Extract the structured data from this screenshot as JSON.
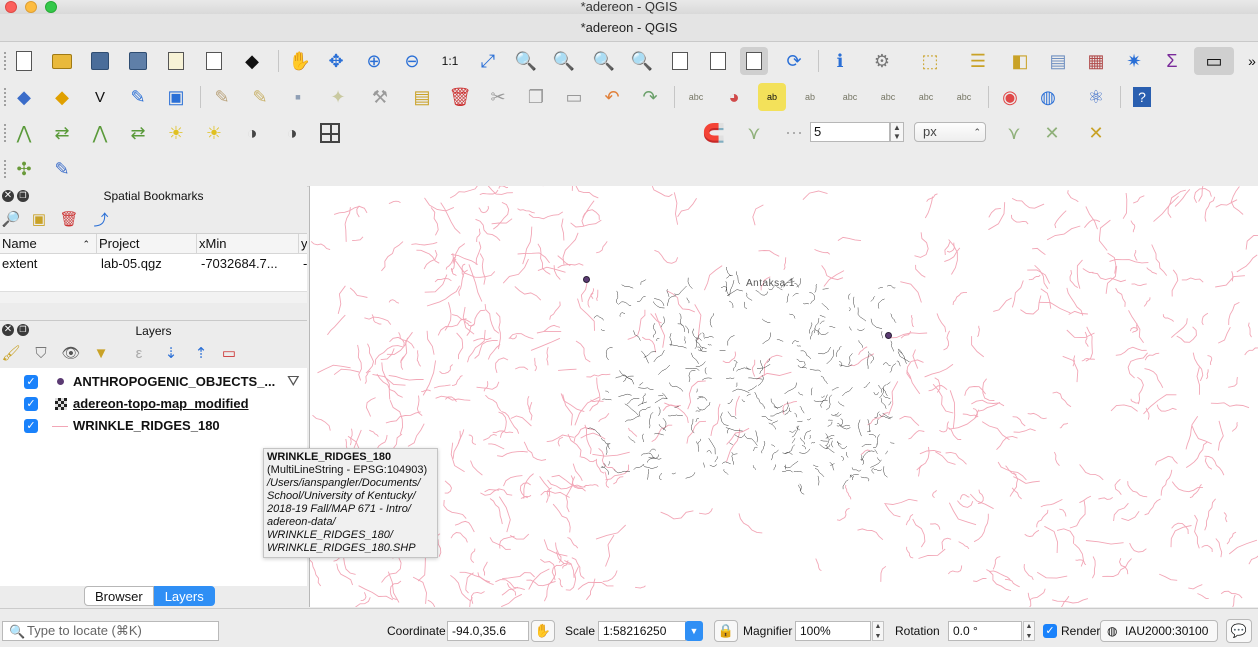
{
  "window": {
    "title": "*adereon - QGIS",
    "tab_title": "*adereon - QGIS"
  },
  "toolbar3": {
    "snap_tolerance": "5",
    "snap_units": "px"
  },
  "bookmarks_panel": {
    "title": "Spatial Bookmarks",
    "columns": [
      "Name",
      "Project",
      "xMin",
      "y"
    ],
    "rows": [
      {
        "name": "extent",
        "project": "lab-05.qgz",
        "xmin": "-7032684.7...",
        "y": "-"
      }
    ]
  },
  "layers_panel": {
    "title": "Layers",
    "layers": [
      {
        "name": "ANTHROPOGENIC_OBJECTS_...",
        "checked": true,
        "symbol": "point-symbol-icon"
      },
      {
        "name": "adereon-topo-map_modified",
        "checked": true,
        "symbol": "raster-symbol-icon"
      },
      {
        "name": "WRINKLE_RIDGES_180",
        "checked": true,
        "symbol": "line-symbol-icon"
      }
    ],
    "tabs": [
      "Browser",
      "Layers"
    ],
    "active_tab": "Layers"
  },
  "tooltip": {
    "title": "WRINKLE_RIDGES_180",
    "crs_line": "(MultiLineString - EPSG:104903)",
    "path_lines": [
      "/Users/ianspangler/Documents/",
      "School/University of Kentucky/",
      "2018-19 Fall/MAP 671 - Intro/",
      "adereon-data/",
      "WRINKLE_RIDGES_180/",
      "WRINKLE_RIDGES_180.SHP"
    ]
  },
  "map": {
    "label": "Antaksa.1",
    "ridge_color": "#f2a6b6",
    "topo_color": "#3a3a3a",
    "point_color": "#5b3b73"
  },
  "statusbar": {
    "locate_placeholder": "Type to locate (⌘K)",
    "coordinate_label": "Coordinate",
    "coordinate_value": "-94.0,35.6",
    "scale_label": "Scale",
    "scale_value": "1:58216250",
    "magnifier_label": "Magnifier",
    "magnifier_value": "100%",
    "rotation_label": "Rotation",
    "rotation_value": "0.0 °",
    "render_label": "Render",
    "render_checked": true,
    "crs": "IAU2000:30100"
  }
}
